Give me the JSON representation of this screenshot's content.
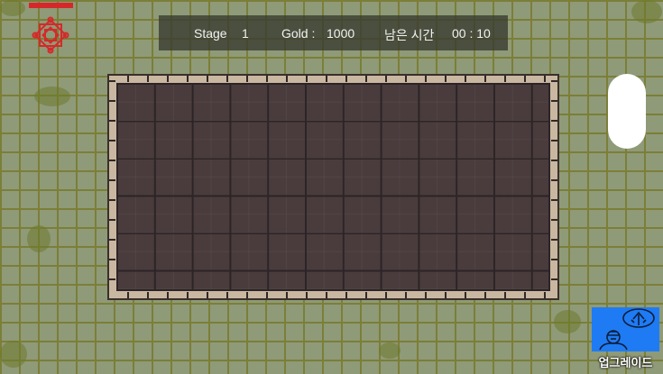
{
  "hud": {
    "stage_label": "Stage",
    "stage_value": "1",
    "gold_label": "Gold :",
    "gold_value": "1000",
    "time_label": "남은 시간",
    "time_value": "00 : 10"
  },
  "player": {
    "health_fraction": 1.0,
    "health_color": "#d62828",
    "icon": "red-rune-icon"
  },
  "board": {
    "rows": 6,
    "columns": 12
  },
  "upgrade": {
    "label": "업그레이드",
    "icon": "upgrade-arrow-icon",
    "button_color": "#1f7bf3"
  }
}
